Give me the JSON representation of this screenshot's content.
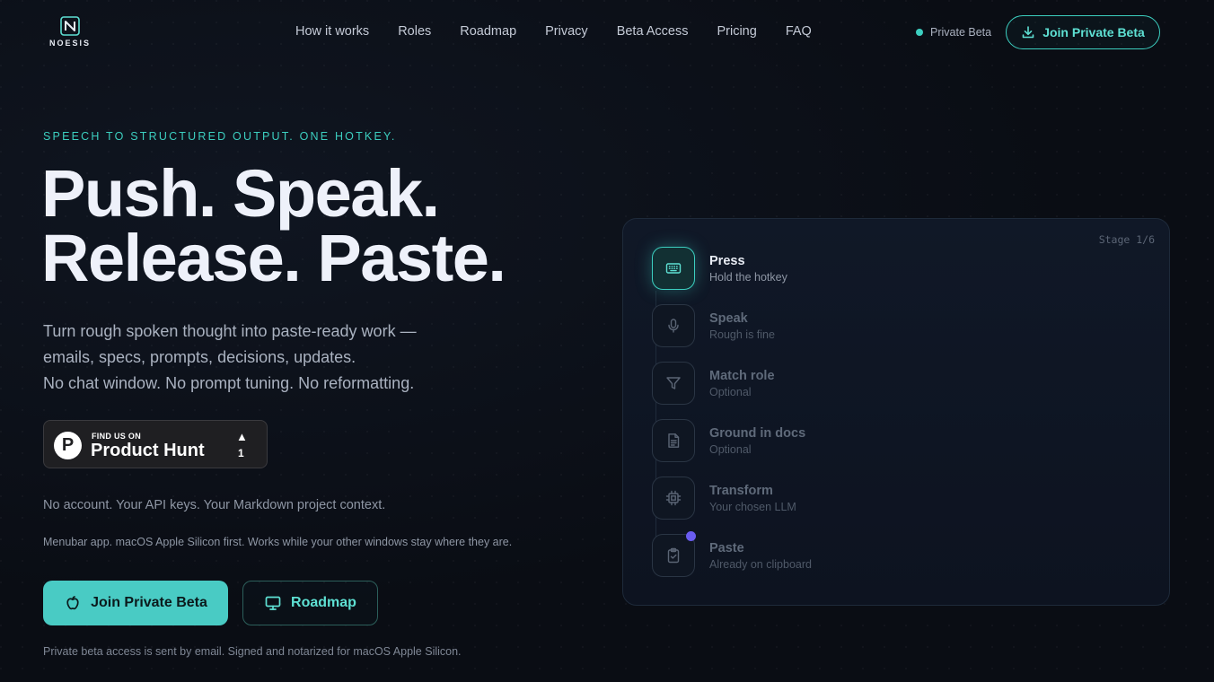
{
  "brand": {
    "name": "NOESIS"
  },
  "nav": {
    "links": [
      "How it works",
      "Roles",
      "Roadmap",
      "Privacy",
      "Beta Access",
      "Pricing",
      "FAQ"
    ],
    "status_label": "Private Beta",
    "cta_label": "Join Private Beta"
  },
  "hero": {
    "eyebrow": "SPEECH TO STRUCTURED OUTPUT. ONE HOTKEY.",
    "headline_line1": "Push. Speak.",
    "headline_line2": "Release. Paste.",
    "subtitle_line1": "Turn rough spoken thought into paste-ready work —",
    "subtitle_line2": "emails, specs, prompts, decisions, updates.",
    "subtitle_line3": "No chat window. No prompt tuning. No reformatting.",
    "product_hunt": {
      "small": "FIND US ON",
      "big": "Product Hunt",
      "arrow": "▲",
      "count": "1"
    },
    "note_account": "No account. Your API keys. Your Markdown project context.",
    "note_platform": "Menubar app. macOS Apple Silicon first. Works while your other windows stay where they are.",
    "primary_cta": "Join Private Beta",
    "secondary_cta": "Roadmap",
    "footnote": "Private beta access is sent by email. Signed and notarized for macOS Apple Silicon."
  },
  "pipeline": {
    "stage_label": "Stage 1/6",
    "steps": [
      {
        "title": "Press",
        "sub": "Hold the hotkey",
        "icon": "keyboard-icon"
      },
      {
        "title": "Speak",
        "sub": "Rough is fine",
        "icon": "microphone-icon"
      },
      {
        "title": "Match role",
        "sub": "Optional",
        "icon": "filter-icon"
      },
      {
        "title": "Ground in docs",
        "sub": "Optional",
        "icon": "document-icon"
      },
      {
        "title": "Transform",
        "sub": "Your chosen LLM",
        "icon": "chip-icon"
      },
      {
        "title": "Paste",
        "sub": "Already on clipboard",
        "icon": "clipboard-check-icon"
      }
    ]
  },
  "colors": {
    "accent": "#3ccfc0",
    "background": "#0a0d14",
    "indicator": "#6a5cf0"
  }
}
